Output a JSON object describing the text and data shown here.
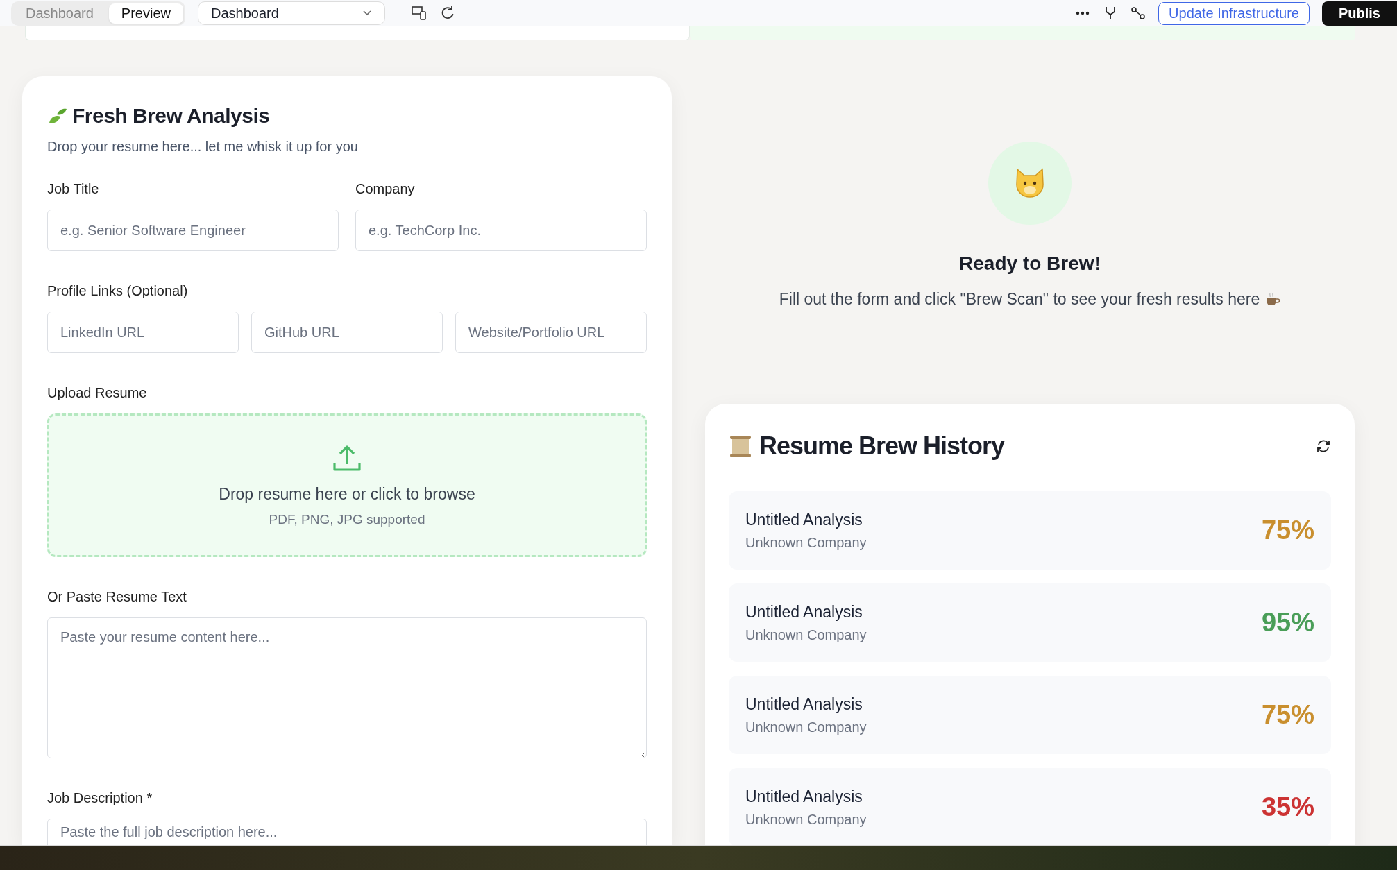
{
  "toolbar": {
    "tabs": [
      {
        "label": "Dashboard",
        "selected": false
      },
      {
        "label": "Preview",
        "selected": true
      }
    ],
    "page_select": {
      "value": "Dashboard"
    },
    "buttons": [
      {
        "label": "Update Infrastructure",
        "kind": "outline"
      },
      {
        "label": "Publis",
        "kind": "solid"
      }
    ]
  },
  "analysis": {
    "title": "Fresh Brew Analysis",
    "subtitle": "Drop your resume here... let me whisk it up for you",
    "fields": [
      {
        "label": "Job Title",
        "placeholder": "e.g. Senior Software Engineer"
      },
      {
        "label": "Company",
        "placeholder": "e.g. TechCorp Inc."
      }
    ],
    "links": {
      "label": "Profile Links (Optional)",
      "fields": [
        {
          "placeholder": "LinkedIn URL"
        },
        {
          "placeholder": "GitHub URL"
        },
        {
          "placeholder": "Website/Portfolio URL"
        }
      ]
    },
    "upload": {
      "label": "Upload Resume",
      "text": "Drop resume here or click to browse",
      "hint": "PDF, PNG, JPG supported"
    },
    "paste": {
      "label": "Or Paste Resume Text",
      "placeholder": "Paste your resume content here..."
    },
    "job_description": {
      "label": "Job Description *",
      "placeholder": "Paste the full job description here..."
    }
  },
  "ready": {
    "title": "Ready to Brew!",
    "text": "Fill out the form and click \"Brew Scan\" to see your fresh results here"
  },
  "history": {
    "title": "Resume Brew History",
    "items": [
      {
        "title": "Untitled Analysis",
        "company": "Unknown Company",
        "score": "75%",
        "color": "#c98f2e"
      },
      {
        "title": "Untitled Analysis",
        "company": "Unknown Company",
        "score": "95%",
        "color": "#4a9e58"
      },
      {
        "title": "Untitled Analysis",
        "company": "Unknown Company",
        "score": "75%",
        "color": "#c98f2e"
      },
      {
        "title": "Untitled Analysis",
        "company": "Unknown Company",
        "score": "35%",
        "color": "#cc3333"
      }
    ]
  }
}
